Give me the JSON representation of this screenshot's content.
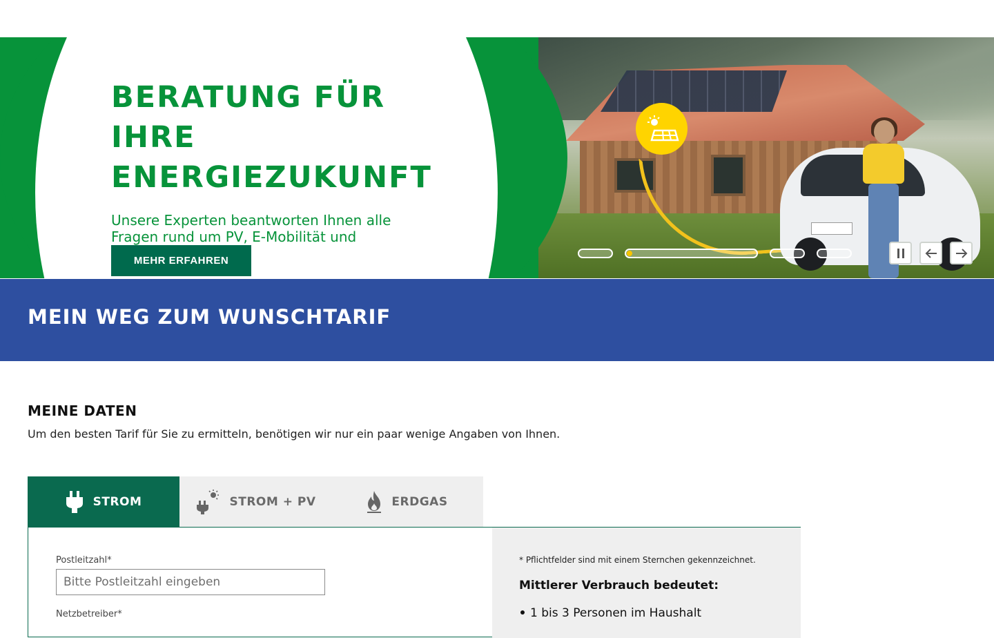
{
  "hero": {
    "title_lines": [
      "BERATUNG FÜR",
      "IHRE",
      "ENERGIEZUKUNFT"
    ],
    "subtitle": "Unsere Experten beantworten Ihnen alle Fragen rund um PV, E-Mobilität und Wärmepumpe",
    "cta_label": "MEHR ERFAHREN",
    "slides_count": 4,
    "active_slide_index": 1,
    "colors": {
      "brand_green": "#07933a",
      "cta_green": "#006a4d",
      "accent_yellow": "#f7c400"
    },
    "icons": [
      "solar-sun-icon",
      "pause-icon",
      "arrow-left-icon",
      "arrow-right-icon"
    ]
  },
  "band": {
    "title": "MEIN WEG ZUM WUNSCHTARIF",
    "color": "#2e4fa0"
  },
  "meine_daten": {
    "title": "MEINE DATEN",
    "description": "Um den besten Tarif für Sie zu ermitteln, benötigen wir nur ein paar wenige Angaben von Ihnen."
  },
  "tabs": [
    {
      "label": "STROM",
      "icon": "plug-icon",
      "active": true
    },
    {
      "label": "STROM + PV",
      "icon": "plug-sun-icon",
      "active": false
    },
    {
      "label": "ERDGAS",
      "icon": "flame-icon",
      "active": false
    }
  ],
  "form": {
    "postleitzahl_label": "Postleitzahl*",
    "postleitzahl_placeholder": "Bitte Postleitzahl eingeben",
    "postleitzahl_value": "",
    "netzbetreiber_label": "Netzbetreiber*"
  },
  "info": {
    "note": "* Pflichtfelder sind mit einem Sternchen gekennzeichnet.",
    "title": "Mittlerer Verbrauch bedeutet:",
    "items": [
      "1 bis 3 Personen im Haushalt"
    ]
  }
}
